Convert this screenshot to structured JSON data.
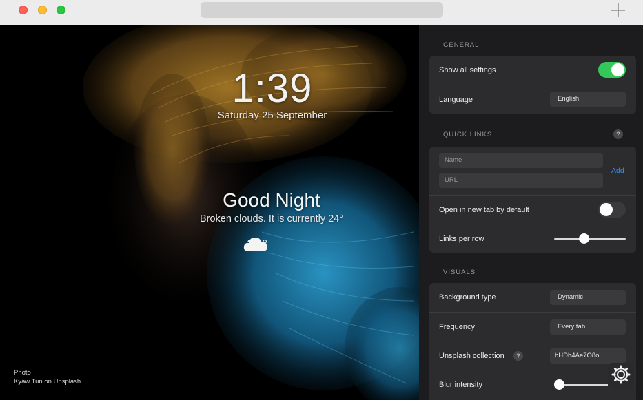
{
  "window": {
    "traffic_lights": [
      "close",
      "minimize",
      "zoom"
    ],
    "new_tab_icon": "plus-icon"
  },
  "background": {
    "clock": "1:39",
    "date": "Saturday 25 September",
    "greeting": "Good Night",
    "weather_description": "Broken clouds. It is currently 24°",
    "weather_icon": "cloud-icon",
    "temperature": "24°",
    "credit_line1": "Photo",
    "credit_line2": "Kyaw Tun on Unsplash"
  },
  "settings": {
    "general": {
      "title": "GENERAL",
      "show_all_label": "Show all settings",
      "show_all_on": true,
      "language_label": "Language",
      "language_value": "English"
    },
    "quick_links": {
      "title": "QUICK LINKS",
      "help": "?",
      "name_placeholder": "Name",
      "url_placeholder": "URL",
      "add_label": "Add",
      "new_tab_label": "Open in new tab by default",
      "new_tab_on": false,
      "links_per_row_label": "Links per row",
      "links_per_row_position": 0.42
    },
    "visuals": {
      "title": "VISUALS",
      "background_type_label": "Background type",
      "background_type_value": "Dynamic",
      "frequency_label": "Frequency",
      "frequency_value": "Every tab",
      "collection_label": "Unsplash collection",
      "collection_help": "?",
      "collection_value": "bHDh4Ae7O8o",
      "blur_label": "Blur intensity",
      "blur_position": 0.0
    }
  },
  "colors": {
    "toggle_on": "#34c759",
    "link_accent": "#2f8bf5",
    "panel_bg": "#1c1c1e",
    "card_bg": "#2c2c2e"
  },
  "settings_button_icon": "gear-icon"
}
